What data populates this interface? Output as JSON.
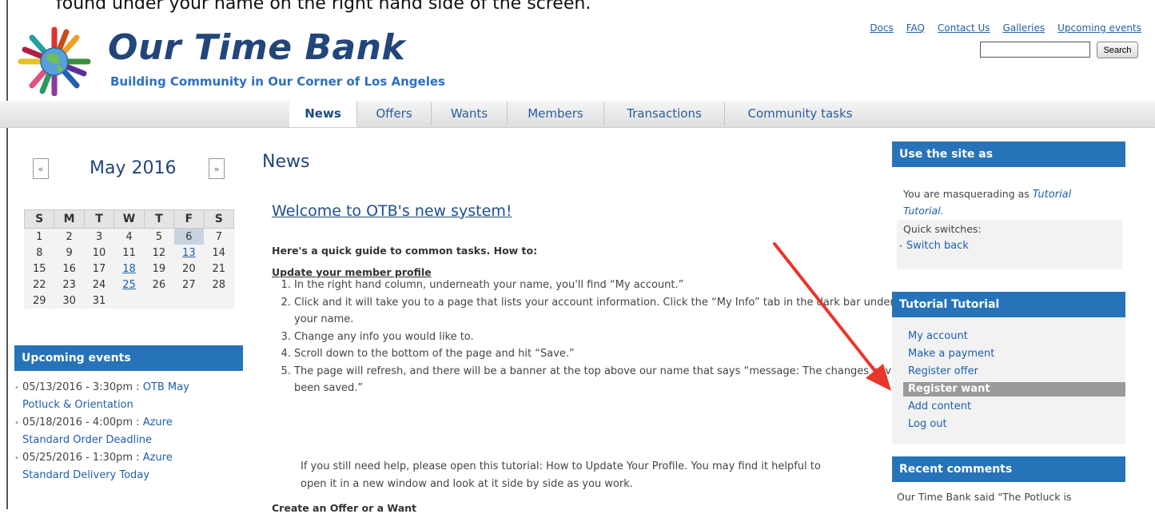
{
  "caption": "found under your name on the right hand side of the screen.",
  "header": {
    "brand": "Our Time Bank",
    "tagline": "Building Community in Our Corner of Los Angeles",
    "top_links": [
      "Docs",
      "FAQ",
      "Contact Us",
      "Galleries",
      "Upcoming events"
    ],
    "search_value": "",
    "search_button": "Search"
  },
  "nav": {
    "items": [
      "News",
      "Offers",
      "Wants",
      "Members",
      "Transactions",
      "Community tasks"
    ],
    "active": "News"
  },
  "calendar": {
    "prev": "«",
    "next": "»",
    "title": "May 2016",
    "weekdays": [
      "S",
      "M",
      "T",
      "W",
      "T",
      "F",
      "S"
    ],
    "weeks": [
      [
        "1",
        "2",
        "3",
        "4",
        "5",
        "6",
        "7"
      ],
      [
        "8",
        "9",
        "10",
        "11",
        "12",
        "13",
        "14"
      ],
      [
        "15",
        "16",
        "17",
        "18",
        "19",
        "20",
        "21"
      ],
      [
        "22",
        "23",
        "24",
        "25",
        "26",
        "27",
        "28"
      ],
      [
        "29",
        "30",
        "31",
        "",
        "",
        "",
        ""
      ]
    ],
    "linked_days": [
      "13",
      "18",
      "25"
    ],
    "today": "6"
  },
  "upcoming": {
    "title": "Upcoming events",
    "items": [
      {
        "date": "05/13/2016 - 3:30pm :",
        "name": "OTB May",
        "name2": "Potluck & Orientation"
      },
      {
        "date": "05/18/2016 - 4:00pm :",
        "name": "Azure",
        "name2": "Standard Order Deadline"
      },
      {
        "date": "05/25/2016 - 1:30pm :",
        "name": "Azure",
        "name2": "Standard Delivery Today"
      }
    ]
  },
  "content": {
    "page_title": "News",
    "post_title": "Welcome to OTB's new system!",
    "intro": "Here's a quick guide to common tasks. How to:",
    "section1": "Update your member profile",
    "steps": [
      "In the right hand column, underneath your name, you'll find “My account.”",
      "Click and it will take you to a page that lists your account information. Click the “My Info” tab in the dark bar under your name.",
      "Change any info you would like to.",
      "Scroll down to the bottom of the page and hit “Save.”",
      "The page will refresh, and there will be a banner at the top above our name that says “message: The changes have been saved.”"
    ],
    "help_line1": "If you still need help, please open this tutorial: How to Update Your Profile. You may find it helpful to",
    "help_line2": "open it in a new window and look at it side by side as you work.",
    "section2": "Create an Offer or a Want"
  },
  "use_site": {
    "title": "Use the site as",
    "masq_prefix": "You are masquerading as",
    "masq_name1": "Tutorial",
    "masq_name2": "Tutorial.",
    "quick": "Quick switches:",
    "switch_back": "Switch back"
  },
  "user_menu": {
    "title": "Tutorial Tutorial",
    "items": [
      "My account",
      "Make a payment",
      "Register offer",
      "Register want",
      "Add content",
      "Log out"
    ],
    "highlighted": "Register want"
  },
  "recent_comments": {
    "title": "Recent comments",
    "first": "Our Time Bank said \"The Potluck is"
  },
  "colors": {
    "brand": "#22457a",
    "block_header": "#2673b9",
    "link": "#1f5fa8",
    "arrow": "#e8372a",
    "highlight": "#9a9a9a"
  }
}
